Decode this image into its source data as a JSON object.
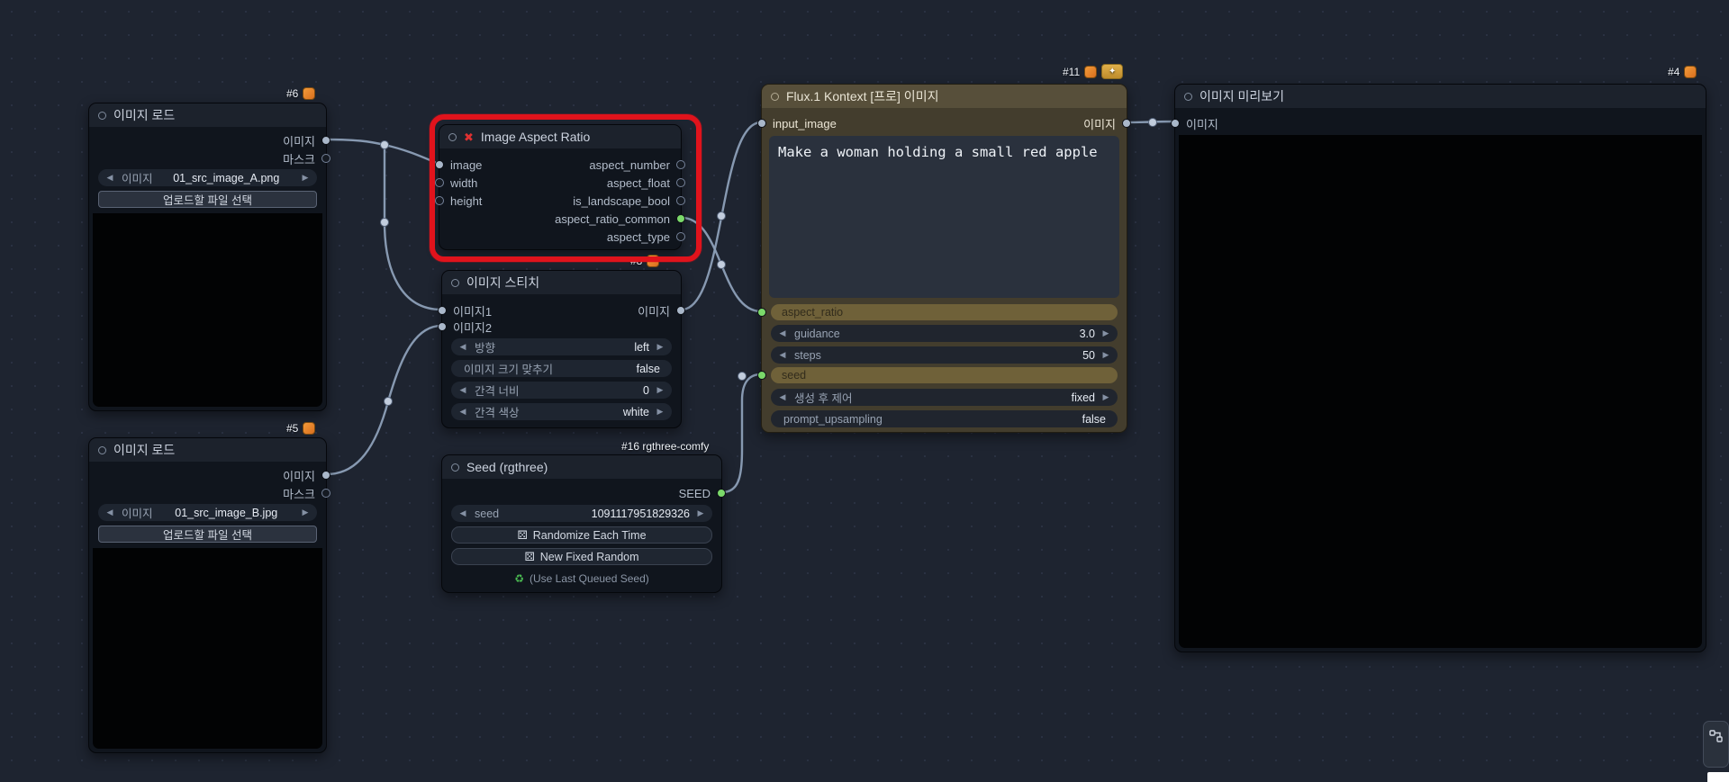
{
  "nodes": {
    "load_a": {
      "badge": "#6",
      "title": "이미지 로드",
      "outputs": {
        "image": "이미지",
        "mask": "마스크"
      },
      "combo": {
        "label": "이미지",
        "value": "01_src_image_A.png"
      },
      "upload_button": "업로드할 파일 선택"
    },
    "load_b": {
      "badge": "#5",
      "title": "이미지 로드",
      "outputs": {
        "image": "이미지",
        "mask": "마스크"
      },
      "combo": {
        "label": "이미지",
        "value": "01_src_image_B.jpg"
      },
      "upload_button": "업로드할 파일 선택"
    },
    "aspect": {
      "title": "Image Aspect Ratio",
      "inputs": [
        "image",
        "width",
        "height"
      ],
      "outputs": [
        "aspect_number",
        "aspect_float",
        "is_landscape_bool",
        "aspect_ratio_common",
        "aspect_type"
      ]
    },
    "stitch": {
      "badge": "#8",
      "title": "이미지 스티치",
      "inputs": [
        "이미지1",
        "이미지2"
      ],
      "output": "이미지",
      "widgets": [
        {
          "label": "방향",
          "value": "left"
        },
        {
          "label": "이미지 크기 맞추기",
          "value": "false"
        },
        {
          "label": "간격 너비",
          "value": "0"
        },
        {
          "label": "간격 색상",
          "value": "white"
        }
      ]
    },
    "seed": {
      "badge": "#16 rgthree-comfy",
      "title": "Seed (rgthree)",
      "output": "SEED",
      "widget": {
        "label": "seed",
        "value": "1091117951829326"
      },
      "randomize_button": "Randomize Each Time",
      "new_fixed_button": "New Fixed Random",
      "hint": "(Use Last Queued Seed)"
    },
    "flux": {
      "badge": "#11",
      "title": "Flux.1 Kontext [프로] 이미지",
      "input": "input_image",
      "output": "이미지",
      "prompt": "Make a woman holding a small red apple",
      "rows": {
        "aspect_ratio": "aspect_ratio",
        "guidance": {
          "label": "guidance",
          "value": "3.0"
        },
        "steps": {
          "label": "steps",
          "value": "50"
        },
        "seed": "seed",
        "control": {
          "label": "생성 후 제어",
          "value": "fixed"
        },
        "upsampling": {
          "label": "prompt_upsampling",
          "value": "false"
        }
      }
    },
    "preview": {
      "badge": "#4",
      "title": "이미지 미리보기",
      "input": "이미지"
    }
  }
}
